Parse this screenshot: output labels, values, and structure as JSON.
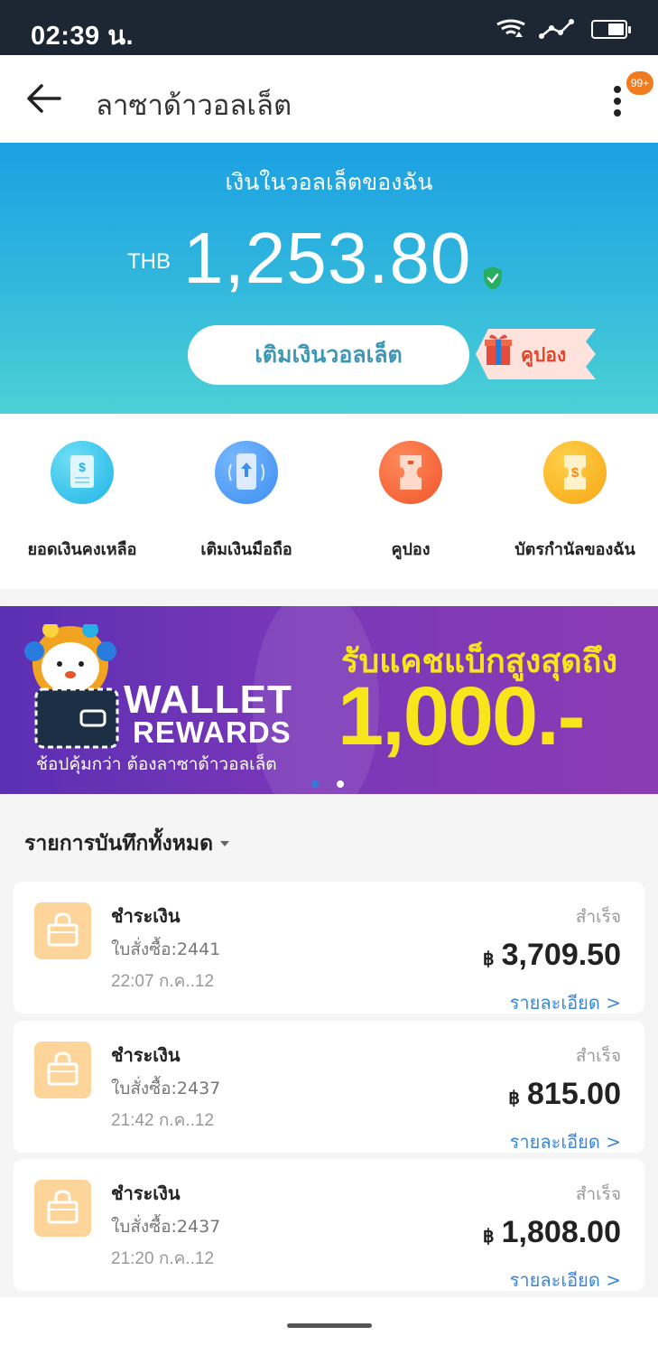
{
  "status_bar": {
    "time": "02:39 น.",
    "icons": [
      "wifi-icon",
      "signal-icon",
      "battery-icon"
    ]
  },
  "header": {
    "title": "ลาซาด้าวอลเล็ต",
    "back_icon": "back-arrow-icon",
    "menu_icon": "more-vertical-icon",
    "badge": "99+"
  },
  "wallet": {
    "label": "เงินในวอลเล็ตของฉัน",
    "currency": "THB",
    "balance": "1,253.80",
    "verified_icon": "shield-check-icon",
    "topup_button": "เติมเงินวอลเล็ต",
    "coupon_tag": "คูปอง"
  },
  "shortcuts": [
    {
      "label": "ยอดเงินคงเหลือ",
      "icon": "balance-receipt-icon",
      "color": "#1fb3e6"
    },
    {
      "label": "เติมเงินมือถือ",
      "icon": "mobile-topup-icon",
      "color": "#3a8ef0"
    },
    {
      "label": "คูปอง",
      "icon": "ticket-icon",
      "color": "#f0552a"
    },
    {
      "label": "บัตรกำนัลของฉัน",
      "icon": "voucher-icon",
      "color": "#f8a614"
    }
  ],
  "banner": {
    "wallet_title": "WALLET",
    "rewards_title": "REWARDS",
    "subtitle": "ช้อปคุ้มกว่า ต้องลาซาด้าวอลเล็ต",
    "headline": "รับแคชแบ็กสูงสุดถึง",
    "amount": "1,000.-"
  },
  "records": {
    "header": "รายการบันทึกทั้งหมด",
    "transactions": [
      {
        "type": "ชำระเงิน",
        "order": "ใบสั่งซื้อ:2441",
        "time": "22:07 ก.ค..12",
        "status": "สำเร็จ",
        "currency_symbol": "฿",
        "amount": "3,709.50",
        "detail": "รายละเอียด >"
      },
      {
        "type": "ชำระเงิน",
        "order": "ใบสั่งซื้อ:2437",
        "time": "21:42 ก.ค..12",
        "status": "สำเร็จ",
        "currency_symbol": "฿",
        "amount": "815.00",
        "detail": "รายละเอียด >"
      },
      {
        "type": "ชำระเงิน",
        "order": "ใบสั่งซื้อ:2437",
        "time": "21:20 ก.ค..12",
        "status": "สำเร็จ",
        "currency_symbol": "฿",
        "amount": "1,808.00",
        "detail": "รายละเอียด >"
      }
    ]
  }
}
